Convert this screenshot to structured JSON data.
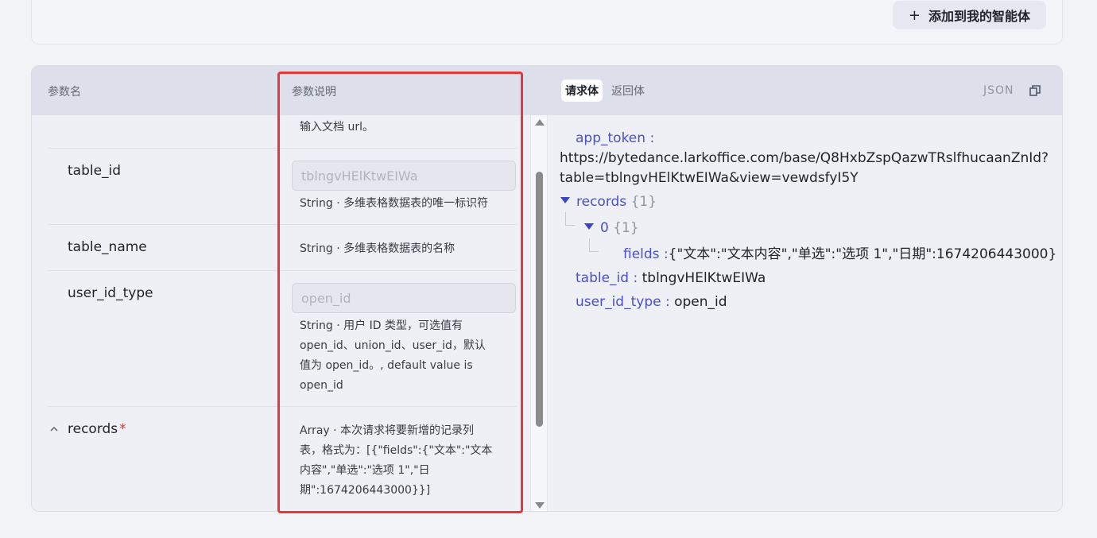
{
  "top_card": {
    "add_agent_label": "添加到我的智能体",
    "add_agent_icon": "plus-icon"
  },
  "table": {
    "header": {
      "param_name": "参数名",
      "param_desc": "参数说明"
    },
    "rows": [
      {
        "name": "",
        "desc": "输入文档 url。"
      },
      {
        "name": "table_id",
        "input_placeholder": "tblngvHElKtwEIWa",
        "desc": "String · 多维表格数据表的唯一标识符"
      },
      {
        "name": "table_name",
        "desc": "String · 多维表格数据表的名称"
      },
      {
        "name": "user_id_type",
        "input_placeholder": "open_id",
        "desc_lines": [
          "String · 用户 ID 类型，可选值有",
          "open_id、union_id、user_id，默认",
          "值为 open_id。, default value is",
          "open_id"
        ]
      },
      {
        "name": "records",
        "required": "*",
        "desc_lines": [
          "Array · 本次请求将要新增的记录列",
          "表，格式为：[{\"fields\":{\"文本\":\"文本",
          "内容\",\"单选\":\"选项 1\",\"日",
          "期\":1674206443000}}]"
        ]
      }
    ]
  },
  "right_panel": {
    "tabs": [
      {
        "label": "请求体",
        "active": true
      },
      {
        "label": "返回体",
        "active": false
      }
    ],
    "format_label": "JSON",
    "json": {
      "app_token_key": "app_token :",
      "app_token_val_1": "https://bytedance.larkoffice.com/base/Q8HxbZspQazwTRslfhucaanZnId?",
      "app_token_val_2": "table=tblngvHElKtwEIWa&view=vewdsfyI5Y",
      "records_key": "records",
      "records_meta": "{1}",
      "item_key": "0",
      "item_meta": "{1}",
      "fields_key": "fields :",
      "fields_val": "{\"文本\":\"文本内容\",\"单选\":\"选项 1\",\"日期\":1674206443000}",
      "table_id_key": "table_id :",
      "table_id_val": "tblngvHElKtwEIWa",
      "user_id_type_key": "user_id_type :",
      "user_id_type_val": "open_id"
    }
  },
  "colors": {
    "highlight": "#e5383b",
    "json_key": "#4a50c8",
    "required": "#e3342f"
  }
}
